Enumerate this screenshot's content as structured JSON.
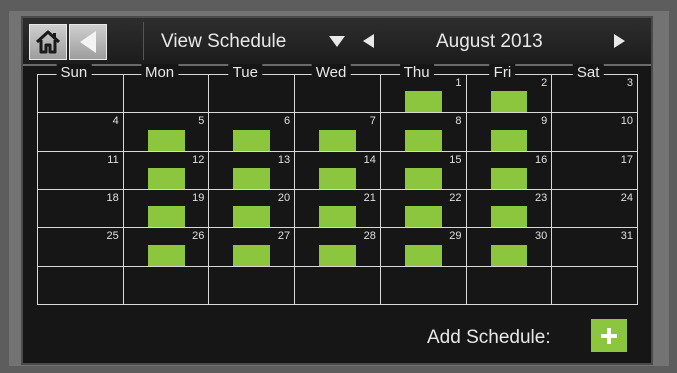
{
  "header": {
    "view_label": "View Schedule",
    "month_label": "August 2013"
  },
  "weekdays": [
    "Sun",
    "Mon",
    "Tue",
    "Wed",
    "Thu",
    "Fri",
    "Sat"
  ],
  "weeks": [
    [
      "",
      "",
      "",
      "",
      "1",
      "2",
      "3"
    ],
    [
      "4",
      "5",
      "6",
      "7",
      "8",
      "9",
      "10"
    ],
    [
      "11",
      "12",
      "13",
      "14",
      "15",
      "16",
      "17"
    ],
    [
      "18",
      "19",
      "20",
      "21",
      "22",
      "23",
      "24"
    ],
    [
      "25",
      "26",
      "27",
      "28",
      "29",
      "30",
      "31"
    ],
    [
      "",
      "",
      "",
      "",
      "",
      "",
      ""
    ]
  ],
  "scheduled_days": [
    "1",
    "2",
    "5",
    "6",
    "7",
    "8",
    "9",
    "12",
    "13",
    "14",
    "15",
    "16",
    "19",
    "20",
    "21",
    "22",
    "23",
    "26",
    "27",
    "28",
    "29",
    "30"
  ],
  "footer": {
    "add_label": "Add Schedule:"
  },
  "colors": {
    "accent": "#8cc63f",
    "background": "#161616",
    "grid": "#d8d8d8"
  }
}
